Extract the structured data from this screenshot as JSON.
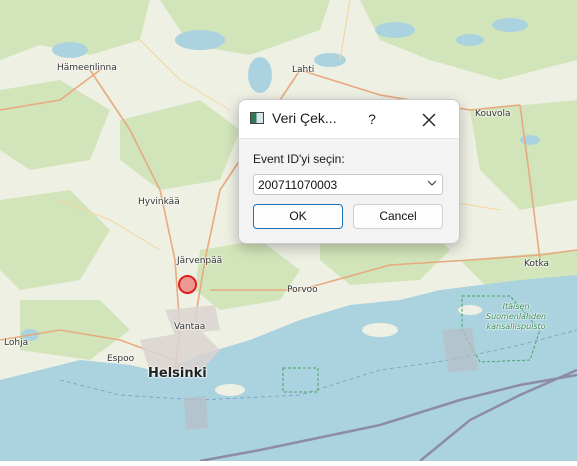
{
  "map": {
    "places": {
      "hameenlinna": "Hämeenlinna",
      "lahti": "Lahti",
      "kouvola": "Kouvola",
      "hyvinkaa": "Hyvinkää",
      "jarvenpaa": "Järvenpää",
      "porvoo": "Porvoo",
      "kotka": "Kotka",
      "vantaa": "Vantaa",
      "lohja": "Lohja",
      "espoo": "Espoo",
      "helsinki": "Helsinki",
      "park_line1": "Itäisen",
      "park_line2": "Suomenlahden",
      "park_line3": "kansallispuisto"
    },
    "colors": {
      "land": "#f2efe9",
      "forest": "#cde3b4",
      "water": "#aad3df",
      "marker": "#e21d1d"
    }
  },
  "dialog": {
    "title": "Veri Çek...",
    "help_label": "?",
    "close_icon": "close-icon",
    "prompt": "Event ID'yi seçin:",
    "selected_event": "200711070003",
    "ok_label": "OK",
    "cancel_label": "Cancel"
  }
}
